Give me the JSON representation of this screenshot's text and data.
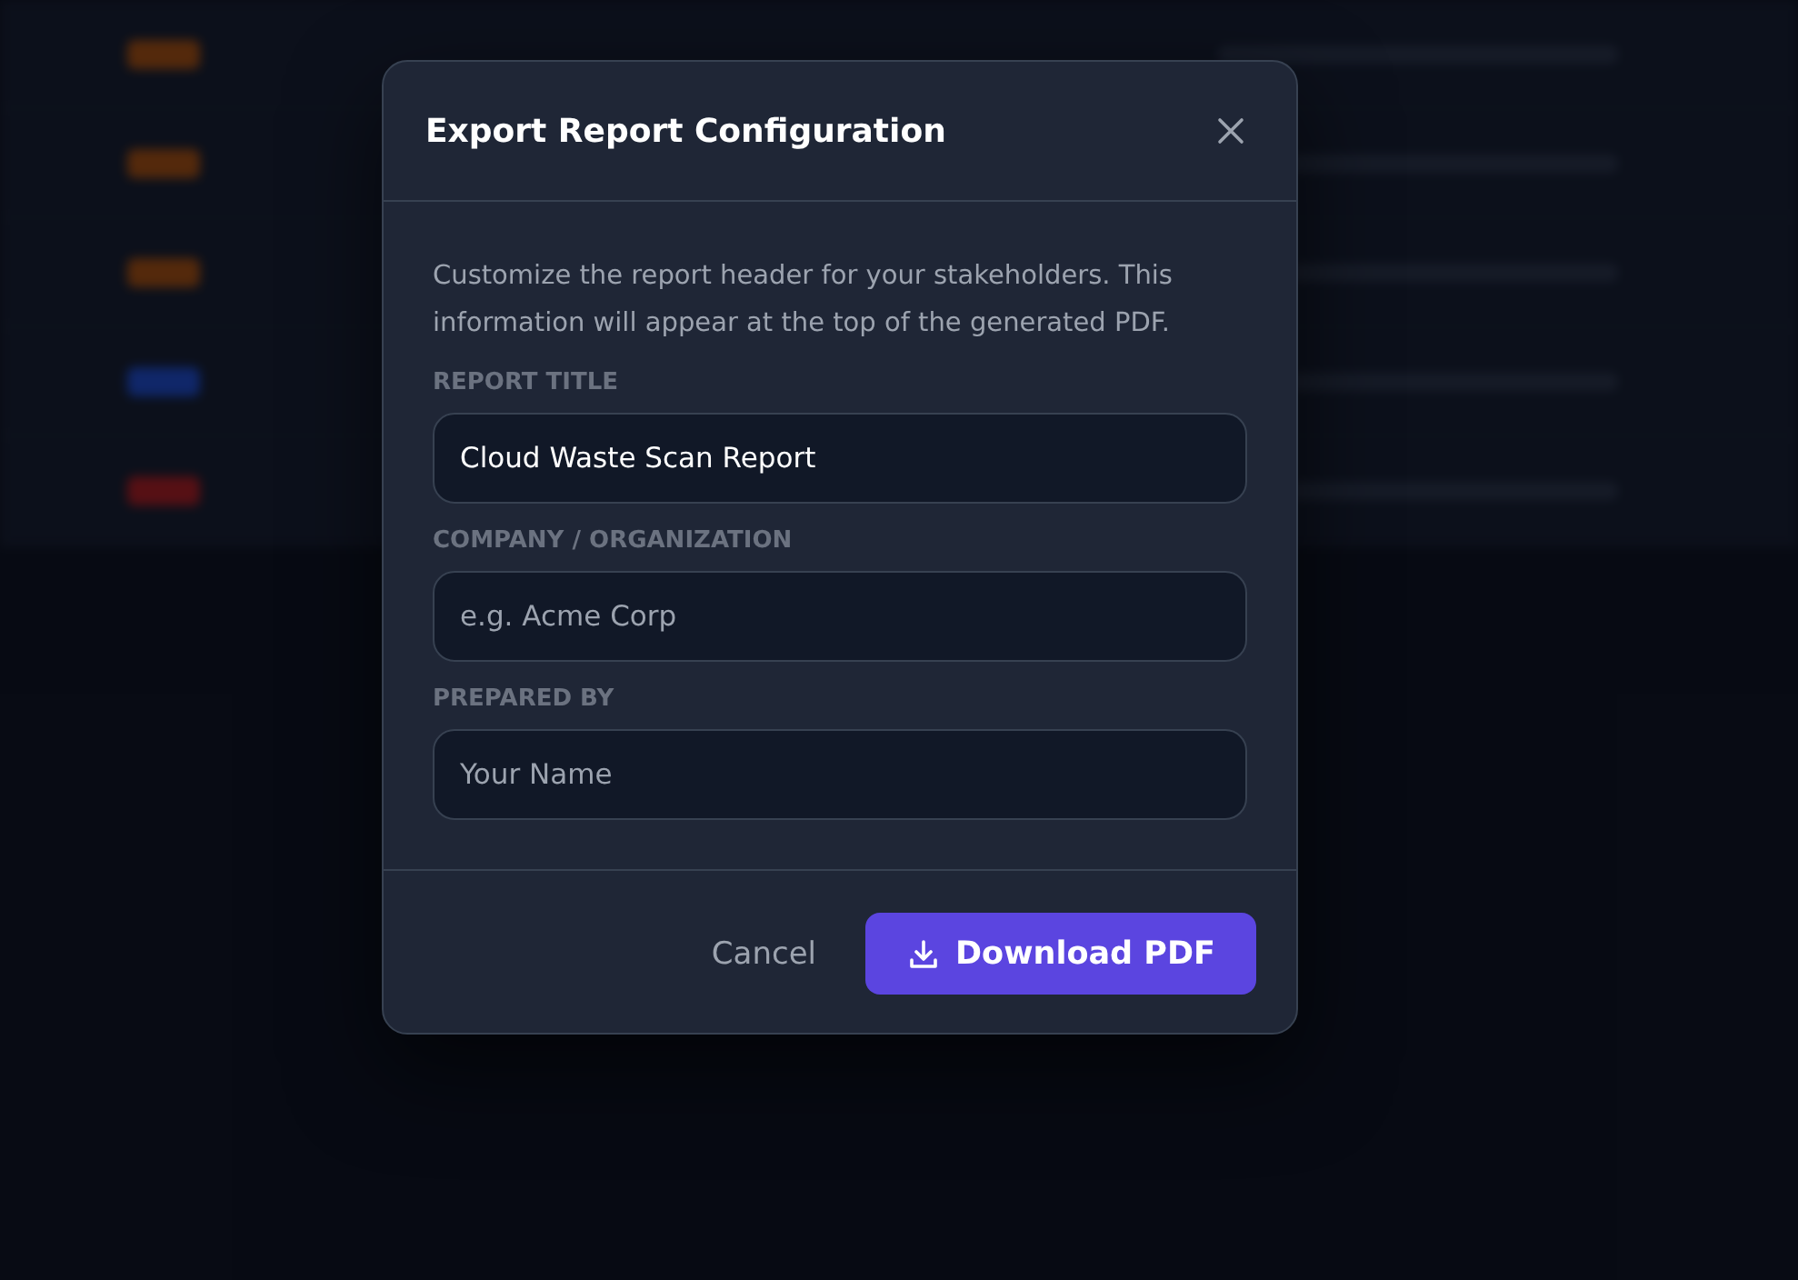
{
  "dialog": {
    "title": "Export Report Configuration",
    "description": "Customize the report header for your stakeholders. This information will appear at the top of the generated PDF.",
    "fields": [
      {
        "label": "REPORT TITLE",
        "value": "Cloud Waste Scan Report"
      },
      {
        "label": "COMPANY / ORGANIZATION",
        "placeholder": "e.g. Acme Corp"
      },
      {
        "label": "PREPARED BY",
        "placeholder": "Your Name"
      }
    ],
    "cancel": "Cancel",
    "download": "Download PDF"
  }
}
